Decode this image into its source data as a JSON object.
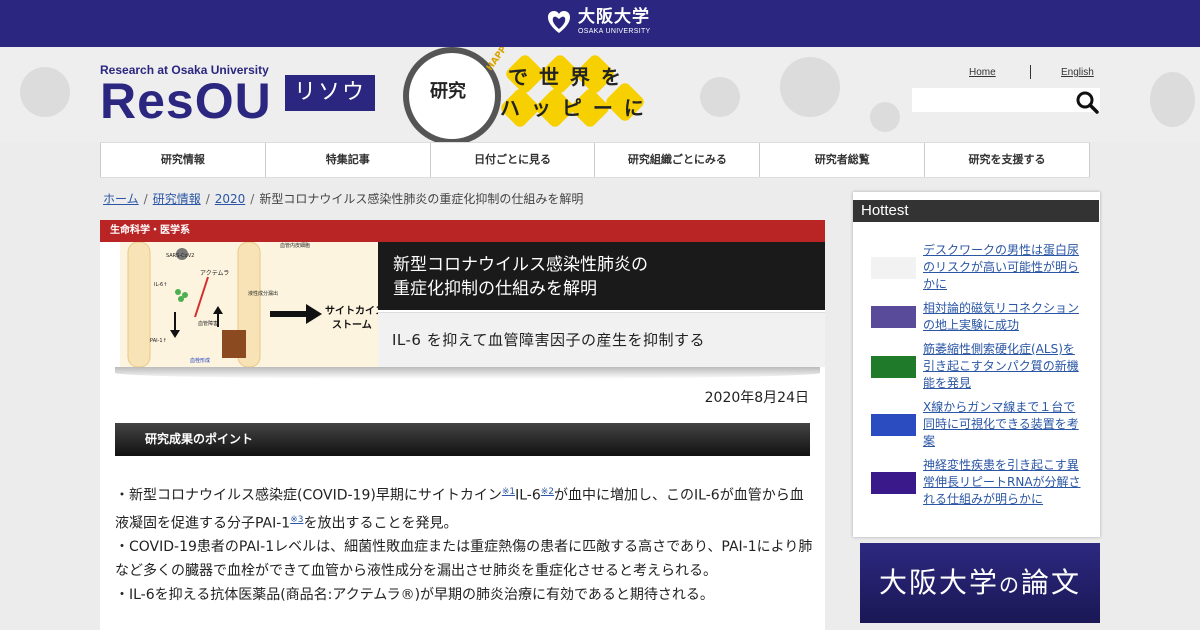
{
  "topbar": {
    "university_jp": "大阪大学",
    "university_en": "OSAKA UNIVERSITY"
  },
  "header": {
    "site_en": "Research at Osaka University",
    "site_name": "ResOU",
    "site_kana": "リソウ",
    "happy_main": "研究",
    "happy_line1": "で 世 界 を",
    "happy_line2": "ハ ッ ピ ー に",
    "happy_small": "HAPPY",
    "home": "Home",
    "english": "English",
    "search_placeholder": ""
  },
  "nav": [
    "研究情報",
    "特集記事",
    "日付ごとに見る",
    "研究組織ごとにみる",
    "研究者総覧",
    "研究を支援する"
  ],
  "breadcrumb": {
    "home": "ホーム",
    "research": "研究情報",
    "year": "2020",
    "current": "新型コロナウイルス感染性肺炎の重症化抑制の仕組みを解明"
  },
  "article": {
    "category": "生命科学・医学系",
    "title_line1": "新型コロナウイルス感染性肺炎の",
    "title_line2": "重症化抑制の仕組みを解明",
    "subtitle": "IL-6 を抑えて血管障害因子の産生を抑制する",
    "date": "2020年8月24日",
    "points_heading": "研究成果のポイント",
    "figure": {
      "label_sars": "SARS-CoV2",
      "label_actemra": "アクテムラ",
      "label_il6": "IL-6↑",
      "label_pai": "PAI-1↑",
      "label_vessel": "血管障害",
      "label_leak": "液性成分漏出",
      "label_endo": "血管内皮細胞",
      "label_thrombus": "血栓形成",
      "label_storm1": "サイトカイン",
      "label_storm2": "ストーム"
    },
    "p1a": "・新型コロナウイルス感染症(COVID-19)早期にサイトカイン",
    "ref1": "※1",
    "p1b": "IL-6",
    "ref2": "※2",
    "p1c": "が血中に増加し、このIL-6が血管から血液凝固を促進する分子PAI-1",
    "ref3": "※3",
    "p1d": "を放出することを発見。",
    "p2": "・COVID-19患者のPAI-1レベルは、細菌性敗血症または重症熱傷の患者に匹敵する高さであり、PAI-1により肺など多くの臓器で血栓ができて血管から液性成分を漏出させ肺炎を重症化させると考えられる。",
    "p3": "・IL-6を抑える抗体医薬品(商品名:アクテムラ®)が早期の肺炎治療に有効であると期待される。"
  },
  "sidebar": {
    "heading": "Hottest",
    "items": [
      {
        "title": "デスクワークの男性は蛋白尿のリスクが高い可能性が明らかに",
        "thumb_color": "#f2f2f2"
      },
      {
        "title": "相対論的磁気リコネクションの地上実験に成功",
        "thumb_color": "#5a4a9a"
      },
      {
        "title": "筋萎縮性側索硬化症(ALS)を引き起こすタンパク質の新機能を発見",
        "thumb_color": "#1f7a2a"
      },
      {
        "title": "X線からガンマ線まで１台で同時に可視化できる装置を考案",
        "thumb_color": "#2a4cc0"
      },
      {
        "title": "神経変性疾患を引き起こす異常伸長リピートRNAが分解される仕組みが明らかに",
        "thumb_color": "#3a1a8a"
      }
    ],
    "banner_a": "大阪大学",
    "banner_b": "の",
    "banner_c": "論文"
  }
}
